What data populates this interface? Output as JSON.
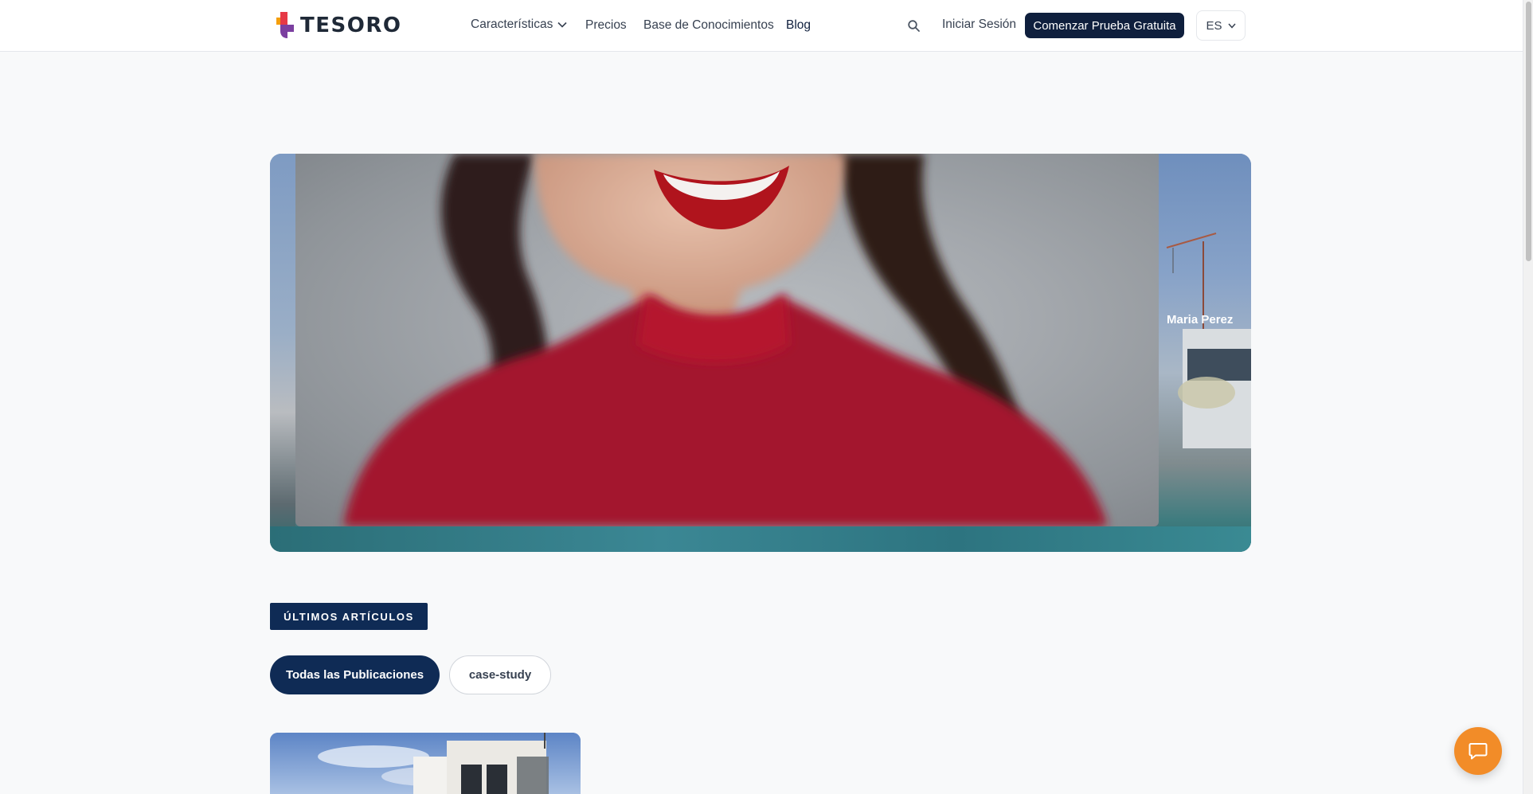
{
  "brand": {
    "name": "TESORO",
    "colors": {
      "red": "#e63946",
      "purple": "#7b3fa0",
      "orange": "#f59e0b",
      "navy": "#0f1f3d"
    }
  },
  "nav": {
    "items": [
      {
        "label": "Características",
        "has_dropdown": true
      },
      {
        "label": "Precios"
      },
      {
        "label": "Base de Conocimientos"
      },
      {
        "label": "Blog",
        "active": true
      }
    ],
    "search_icon": "search-icon",
    "signin_label": "Iniciar Sesión",
    "cta_label": "Comenzar Prueba Gratuita",
    "language": "ES"
  },
  "hero": {
    "caption": "Maria Perez"
  },
  "latest": {
    "badge_label": "ÚLTIMOS ARTÍCULOS",
    "filters": [
      {
        "label": "Todas las Publicaciones",
        "active": true
      },
      {
        "label": "case-study",
        "active": false
      }
    ]
  },
  "chat": {
    "icon": "chat-icon",
    "color": "#f28c28"
  }
}
